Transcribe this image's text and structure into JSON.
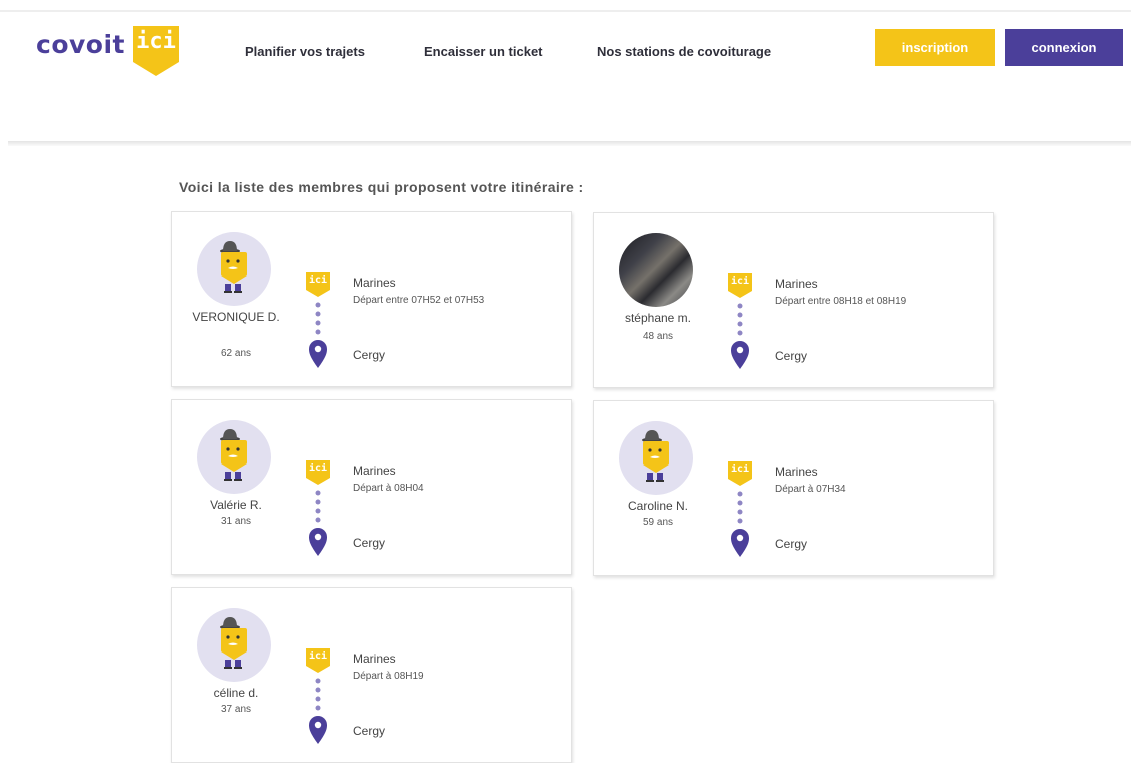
{
  "brand": {
    "name_prefix": "covoit",
    "name_badge": "ici"
  },
  "nav": [
    "Planifier vos trajets",
    "Encaisser un ticket",
    "Nos stations de covoiturage"
  ],
  "buttons": {
    "inscription": "inscription",
    "connexion": "connexion"
  },
  "intro": "Voici la liste des membres qui proposent votre itinéraire :",
  "route_badge": "ici",
  "members": [
    {
      "name": "VERONIQUE D.",
      "age": "62 ans",
      "from": "Marines",
      "departure": "Départ entre 07H52 et 07H53",
      "to": "Cergy",
      "avatar": "mascot"
    },
    {
      "name": "stéphane m.",
      "age": "48 ans",
      "from": "Marines",
      "departure": "Départ entre 08H18 et 08H19",
      "to": "Cergy",
      "avatar": "photo"
    },
    {
      "name": "Valérie R.",
      "age": "31 ans",
      "from": "Marines",
      "departure": "Départ à 08H04",
      "to": "Cergy",
      "avatar": "mascot"
    },
    {
      "name": "Caroline N.",
      "age": "59 ans",
      "from": "Marines",
      "departure": "Départ à 07H34",
      "to": "Cergy",
      "avatar": "mascot"
    },
    {
      "name": "céline d.",
      "age": "37 ans",
      "from": "Marines",
      "departure": "Départ à 08H19",
      "to": "Cergy",
      "avatar": "mascot"
    }
  ],
  "colors": {
    "yellow": "#f4c418",
    "purple": "#4b3f9a",
    "avatar_bg": "#e2e0f0"
  },
  "icons": {
    "route_start": "ici-badge-icon",
    "route_end": "map-pin-icon",
    "avatar": "mascot-icon"
  }
}
